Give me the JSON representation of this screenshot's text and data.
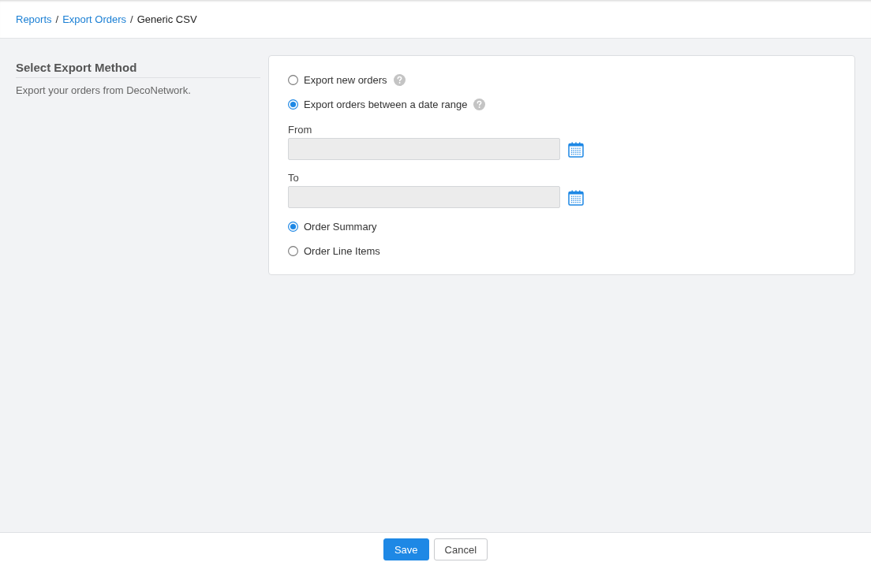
{
  "breadcrumb": [
    {
      "label": "Reports",
      "kind": "link"
    },
    {
      "label": "/",
      "kind": "separator"
    },
    {
      "label": "Export Orders",
      "kind": "link"
    },
    {
      "label": "/",
      "kind": "separator"
    },
    {
      "label": "Generic CSV",
      "kind": "current"
    }
  ],
  "section": {
    "title": "Select Export Method",
    "description": "Export your orders from DecoNetwork."
  },
  "export_options": [
    {
      "label": "Export new orders",
      "selected": false,
      "help": true
    },
    {
      "label": "Export orders between a date range",
      "selected": true,
      "help": true
    }
  ],
  "date_fields": [
    {
      "label": "From",
      "disabled": true
    },
    {
      "label": "To",
      "disabled": true
    }
  ],
  "report_types": [
    {
      "label": "Order Summary",
      "selected": true
    },
    {
      "label": "Order Line Items",
      "selected": false
    }
  ],
  "buttons": [
    {
      "label": "Save",
      "kind": "primary"
    },
    {
      "label": "Cancel",
      "kind": "secondary"
    }
  ]
}
